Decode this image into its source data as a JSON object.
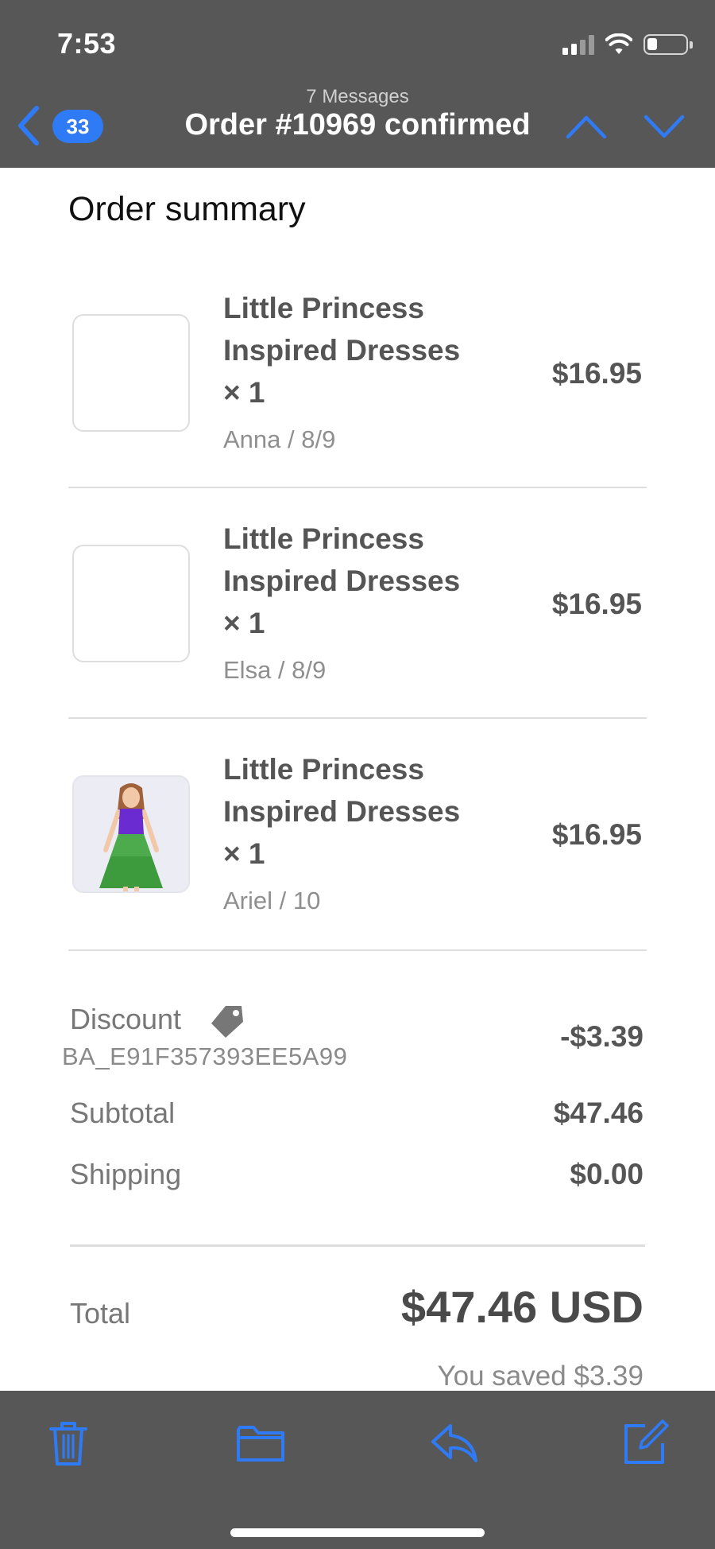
{
  "status_bar": {
    "time": "7:53"
  },
  "nav": {
    "unread_badge": "33",
    "message_count": "7 Messages",
    "title": "Order #10969 confirmed"
  },
  "colors": {
    "accent": "#2f7bf5",
    "bar_bg": "#575757"
  },
  "order": {
    "section_title": "Order summary",
    "items": [
      {
        "name": "Little Princess Inspired Dresses × 1",
        "variant": "Anna / 8/9",
        "price": "$16.95",
        "image": "blank"
      },
      {
        "name": "Little Princess Inspired Dresses × 1",
        "variant": "Elsa / 8/9",
        "price": "$16.95",
        "image": "blank"
      },
      {
        "name": "Little Princess Inspired Dresses × 1",
        "variant": "Ariel / 10",
        "price": "$16.95",
        "image": "girl-in-purple-green-dress-photo"
      }
    ],
    "discount": {
      "label": "Discount",
      "code": "BA_E91F357393EE5A99",
      "value": "-$3.39",
      "icon": "tag-icon"
    },
    "subtotal": {
      "label": "Subtotal",
      "value": "$47.46"
    },
    "shipping": {
      "label": "Shipping",
      "value": "$0.00"
    },
    "total": {
      "label": "Total",
      "value": "$47.46 USD",
      "saved": "You saved $3.39"
    }
  },
  "toolbar": {
    "icons": [
      "trash-icon",
      "folder-icon",
      "reply-icon",
      "compose-icon"
    ]
  }
}
